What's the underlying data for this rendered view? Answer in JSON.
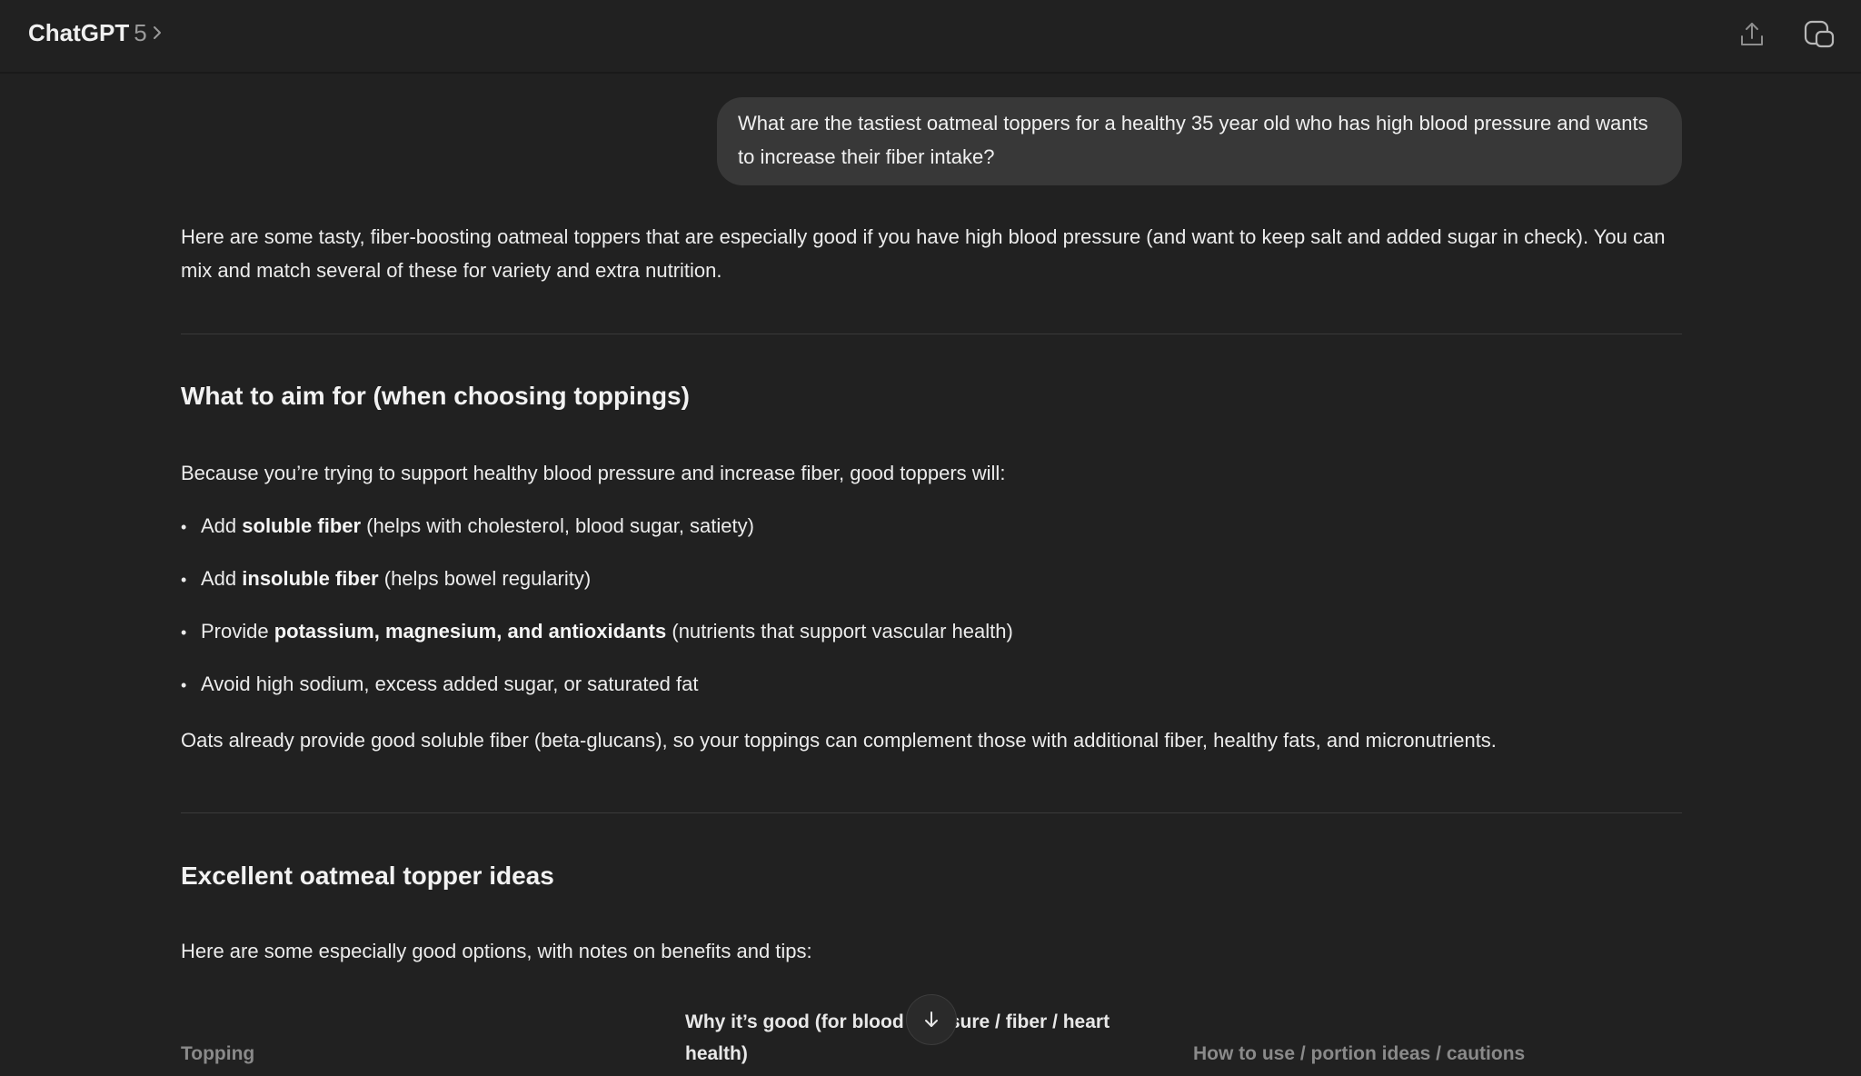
{
  "header": {
    "app_name": "ChatGPT",
    "model_version": "5",
    "icons": [
      "chevron-right-icon",
      "share-icon",
      "new-chat-icon"
    ]
  },
  "user_message": "What are the tastiest oatmeal toppers for a healthy 35 year old who has high blood pressure and wants to increase their fiber intake?",
  "response": {
    "intro": "Here are some tasty, fiber-boosting oatmeal toppers that are especially good if you have high blood pressure (and want to keep salt and added sugar in check). You can mix and match several of these for variety and extra nutrition.",
    "section1": {
      "heading": "What to aim for (when choosing toppings)",
      "lead": "Because you’re trying to support healthy blood pressure and increase fiber, good toppers will:",
      "bullets": [
        {
          "pre": "Add ",
          "bold": "soluble fiber",
          "post": " (helps with cholesterol, blood sugar, satiety)"
        },
        {
          "pre": "Add ",
          "bold": "insoluble fiber",
          "post": " (helps bowel regularity)"
        },
        {
          "pre": "Provide ",
          "bold": "potassium, magnesium, and antioxidants",
          "post": " (nutrients that support vascular health)"
        },
        {
          "pre": "Avoid high sodium, excess added sugar, or saturated fat",
          "bold": "",
          "post": ""
        }
      ],
      "closing": "Oats already provide good soluble fiber (beta-glucans), so your toppings can complement those with additional fiber, healthy fats, and micronutrients."
    },
    "section2": {
      "heading": "Excellent oatmeal topper ideas",
      "lead": "Here are some especially good options, with notes on benefits and tips:",
      "table_headers": [
        "Topping",
        "Why it’s good (for blood pressure / fiber / heart health)",
        "How to use / portion ideas / cautions"
      ]
    }
  },
  "colors": {
    "background": "#212121",
    "bubble": "#383838",
    "text": "#ececec",
    "muted": "#9a9a9a"
  }
}
